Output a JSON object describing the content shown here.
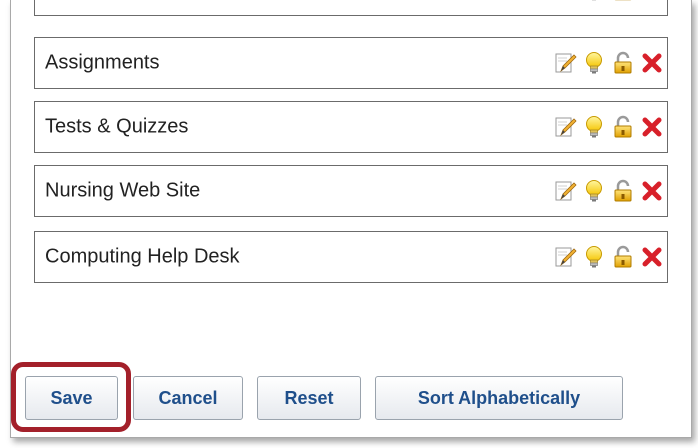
{
  "tools": [
    {
      "label": ""
    },
    {
      "label": "Assignments"
    },
    {
      "label": "Tests & Quizzes"
    },
    {
      "label": "Nursing Web Site"
    },
    {
      "label": "Computing Help Desk"
    }
  ],
  "buttons": {
    "save": "Save",
    "cancel": "Cancel",
    "reset": "Reset",
    "sort": "Sort Alphabetically"
  },
  "colors": {
    "highlight": "#a3202a",
    "button_text": "#1f4f8b",
    "delete": "#d8202a"
  },
  "icons": {
    "edit": "pencil-edit-icon",
    "show": "lightbulb-icon",
    "lock": "padlock-unlocked-icon",
    "delete": "red-x-delete-icon"
  }
}
